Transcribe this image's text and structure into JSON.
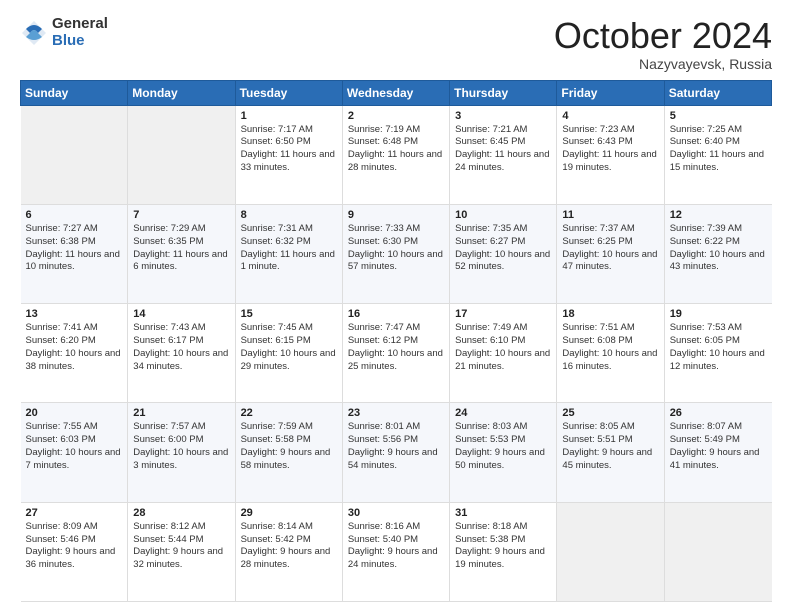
{
  "logo": {
    "general": "General",
    "blue": "Blue"
  },
  "header": {
    "month": "October 2024",
    "location": "Nazyvayevsk, Russia"
  },
  "days_of_week": [
    "Sunday",
    "Monday",
    "Tuesday",
    "Wednesday",
    "Thursday",
    "Friday",
    "Saturday"
  ],
  "weeks": [
    [
      {
        "day": "",
        "sunrise": "",
        "sunset": "",
        "daylight": "",
        "empty": true
      },
      {
        "day": "",
        "sunrise": "",
        "sunset": "",
        "daylight": "",
        "empty": true
      },
      {
        "day": "1",
        "sunrise": "Sunrise: 7:17 AM",
        "sunset": "Sunset: 6:50 PM",
        "daylight": "Daylight: 11 hours and 33 minutes.",
        "empty": false
      },
      {
        "day": "2",
        "sunrise": "Sunrise: 7:19 AM",
        "sunset": "Sunset: 6:48 PM",
        "daylight": "Daylight: 11 hours and 28 minutes.",
        "empty": false
      },
      {
        "day": "3",
        "sunrise": "Sunrise: 7:21 AM",
        "sunset": "Sunset: 6:45 PM",
        "daylight": "Daylight: 11 hours and 24 minutes.",
        "empty": false
      },
      {
        "day": "4",
        "sunrise": "Sunrise: 7:23 AM",
        "sunset": "Sunset: 6:43 PM",
        "daylight": "Daylight: 11 hours and 19 minutes.",
        "empty": false
      },
      {
        "day": "5",
        "sunrise": "Sunrise: 7:25 AM",
        "sunset": "Sunset: 6:40 PM",
        "daylight": "Daylight: 11 hours and 15 minutes.",
        "empty": false
      }
    ],
    [
      {
        "day": "6",
        "sunrise": "Sunrise: 7:27 AM",
        "sunset": "Sunset: 6:38 PM",
        "daylight": "Daylight: 11 hours and 10 minutes.",
        "empty": false
      },
      {
        "day": "7",
        "sunrise": "Sunrise: 7:29 AM",
        "sunset": "Sunset: 6:35 PM",
        "daylight": "Daylight: 11 hours and 6 minutes.",
        "empty": false
      },
      {
        "day": "8",
        "sunrise": "Sunrise: 7:31 AM",
        "sunset": "Sunset: 6:32 PM",
        "daylight": "Daylight: 11 hours and 1 minute.",
        "empty": false
      },
      {
        "day": "9",
        "sunrise": "Sunrise: 7:33 AM",
        "sunset": "Sunset: 6:30 PM",
        "daylight": "Daylight: 10 hours and 57 minutes.",
        "empty": false
      },
      {
        "day": "10",
        "sunrise": "Sunrise: 7:35 AM",
        "sunset": "Sunset: 6:27 PM",
        "daylight": "Daylight: 10 hours and 52 minutes.",
        "empty": false
      },
      {
        "day": "11",
        "sunrise": "Sunrise: 7:37 AM",
        "sunset": "Sunset: 6:25 PM",
        "daylight": "Daylight: 10 hours and 47 minutes.",
        "empty": false
      },
      {
        "day": "12",
        "sunrise": "Sunrise: 7:39 AM",
        "sunset": "Sunset: 6:22 PM",
        "daylight": "Daylight: 10 hours and 43 minutes.",
        "empty": false
      }
    ],
    [
      {
        "day": "13",
        "sunrise": "Sunrise: 7:41 AM",
        "sunset": "Sunset: 6:20 PM",
        "daylight": "Daylight: 10 hours and 38 minutes.",
        "empty": false
      },
      {
        "day": "14",
        "sunrise": "Sunrise: 7:43 AM",
        "sunset": "Sunset: 6:17 PM",
        "daylight": "Daylight: 10 hours and 34 minutes.",
        "empty": false
      },
      {
        "day": "15",
        "sunrise": "Sunrise: 7:45 AM",
        "sunset": "Sunset: 6:15 PM",
        "daylight": "Daylight: 10 hours and 29 minutes.",
        "empty": false
      },
      {
        "day": "16",
        "sunrise": "Sunrise: 7:47 AM",
        "sunset": "Sunset: 6:12 PM",
        "daylight": "Daylight: 10 hours and 25 minutes.",
        "empty": false
      },
      {
        "day": "17",
        "sunrise": "Sunrise: 7:49 AM",
        "sunset": "Sunset: 6:10 PM",
        "daylight": "Daylight: 10 hours and 21 minutes.",
        "empty": false
      },
      {
        "day": "18",
        "sunrise": "Sunrise: 7:51 AM",
        "sunset": "Sunset: 6:08 PM",
        "daylight": "Daylight: 10 hours and 16 minutes.",
        "empty": false
      },
      {
        "day": "19",
        "sunrise": "Sunrise: 7:53 AM",
        "sunset": "Sunset: 6:05 PM",
        "daylight": "Daylight: 10 hours and 12 minutes.",
        "empty": false
      }
    ],
    [
      {
        "day": "20",
        "sunrise": "Sunrise: 7:55 AM",
        "sunset": "Sunset: 6:03 PM",
        "daylight": "Daylight: 10 hours and 7 minutes.",
        "empty": false
      },
      {
        "day": "21",
        "sunrise": "Sunrise: 7:57 AM",
        "sunset": "Sunset: 6:00 PM",
        "daylight": "Daylight: 10 hours and 3 minutes.",
        "empty": false
      },
      {
        "day": "22",
        "sunrise": "Sunrise: 7:59 AM",
        "sunset": "Sunset: 5:58 PM",
        "daylight": "Daylight: 9 hours and 58 minutes.",
        "empty": false
      },
      {
        "day": "23",
        "sunrise": "Sunrise: 8:01 AM",
        "sunset": "Sunset: 5:56 PM",
        "daylight": "Daylight: 9 hours and 54 minutes.",
        "empty": false
      },
      {
        "day": "24",
        "sunrise": "Sunrise: 8:03 AM",
        "sunset": "Sunset: 5:53 PM",
        "daylight": "Daylight: 9 hours and 50 minutes.",
        "empty": false
      },
      {
        "day": "25",
        "sunrise": "Sunrise: 8:05 AM",
        "sunset": "Sunset: 5:51 PM",
        "daylight": "Daylight: 9 hours and 45 minutes.",
        "empty": false
      },
      {
        "day": "26",
        "sunrise": "Sunrise: 8:07 AM",
        "sunset": "Sunset: 5:49 PM",
        "daylight": "Daylight: 9 hours and 41 minutes.",
        "empty": false
      }
    ],
    [
      {
        "day": "27",
        "sunrise": "Sunrise: 8:09 AM",
        "sunset": "Sunset: 5:46 PM",
        "daylight": "Daylight: 9 hours and 36 minutes.",
        "empty": false
      },
      {
        "day": "28",
        "sunrise": "Sunrise: 8:12 AM",
        "sunset": "Sunset: 5:44 PM",
        "daylight": "Daylight: 9 hours and 32 minutes.",
        "empty": false
      },
      {
        "day": "29",
        "sunrise": "Sunrise: 8:14 AM",
        "sunset": "Sunset: 5:42 PM",
        "daylight": "Daylight: 9 hours and 28 minutes.",
        "empty": false
      },
      {
        "day": "30",
        "sunrise": "Sunrise: 8:16 AM",
        "sunset": "Sunset: 5:40 PM",
        "daylight": "Daylight: 9 hours and 24 minutes.",
        "empty": false
      },
      {
        "day": "31",
        "sunrise": "Sunrise: 8:18 AM",
        "sunset": "Sunset: 5:38 PM",
        "daylight": "Daylight: 9 hours and 19 minutes.",
        "empty": false
      },
      {
        "day": "",
        "sunrise": "",
        "sunset": "",
        "daylight": "",
        "empty": true
      },
      {
        "day": "",
        "sunrise": "",
        "sunset": "",
        "daylight": "",
        "empty": true
      }
    ]
  ]
}
